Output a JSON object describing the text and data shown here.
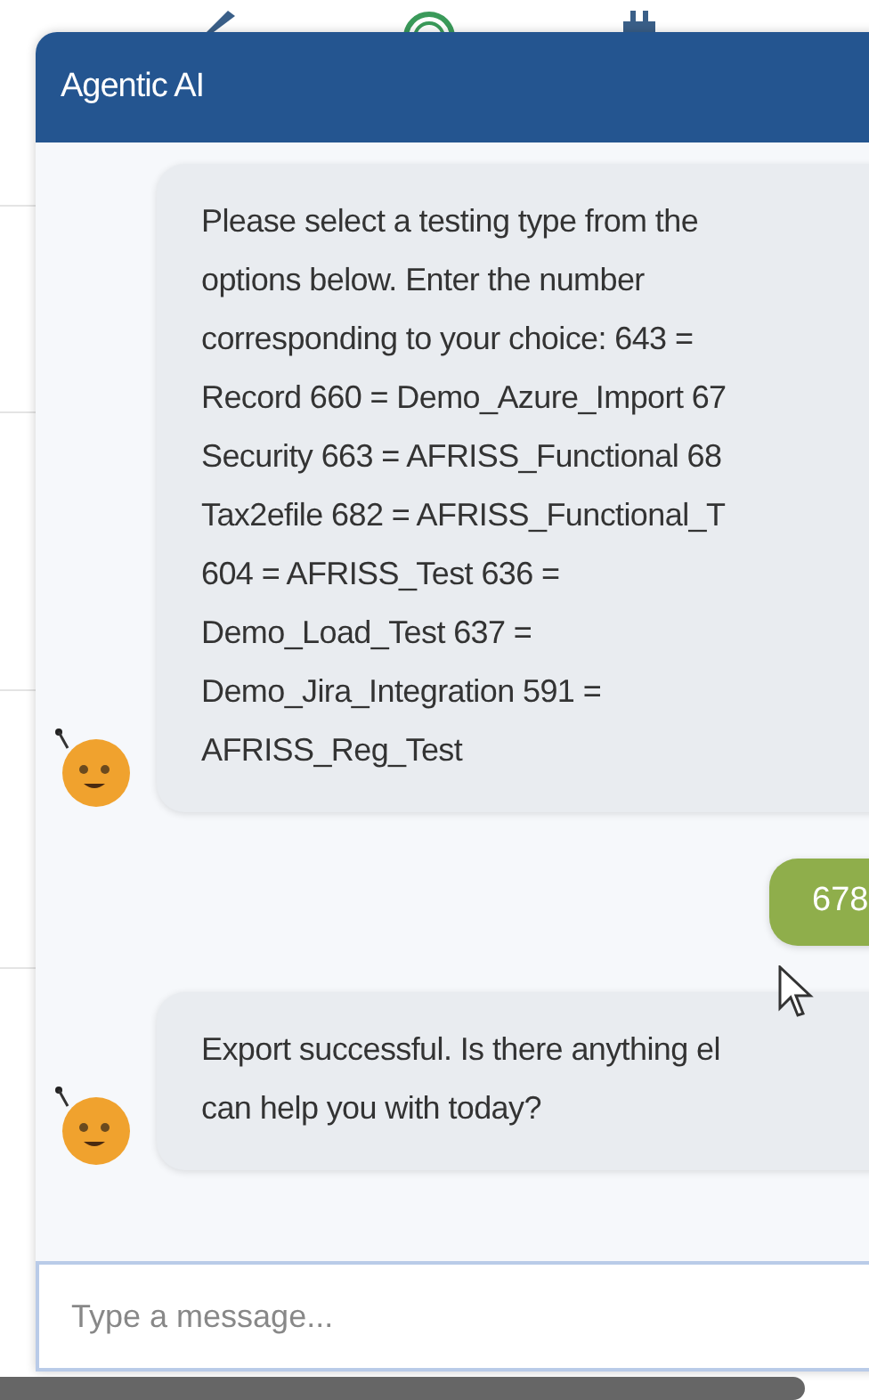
{
  "window": {
    "title": "Agentic AI"
  },
  "messages": [
    {
      "kind": "bot",
      "lines": [
        "Please select a testing type from the",
        "options below. Enter the number",
        "corresponding to your choice: 643 =",
        "Record 660 = Demo_Azure_Import 67",
        "Security 663 = AFRISS_Functional 68",
        "Tax2efile 682 = AFRISS_Functional_T",
        "604 = AFRISS_Test 636 =",
        "Demo_Load_Test 637 =",
        "Demo_Jira_Integration 591 =",
        "AFRISS_Reg_Test"
      ]
    },
    {
      "kind": "user",
      "lines": [
        "678"
      ]
    },
    {
      "kind": "bot",
      "lines": [
        "Export successful. Is there anything el",
        "can help you with today?"
      ]
    }
  ],
  "input": {
    "placeholder": "Type a message..."
  }
}
